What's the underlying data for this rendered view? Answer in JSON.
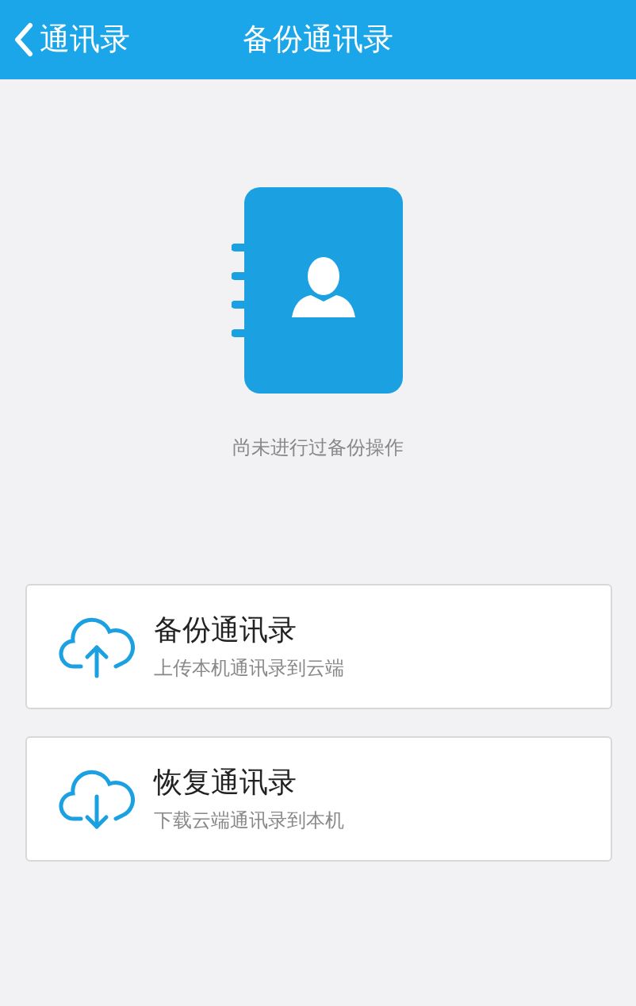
{
  "header": {
    "back_label": "通讯录",
    "title": "备份通讯录"
  },
  "status_text": "尚未进行过备份操作",
  "actions": [
    {
      "kind": "upload",
      "title": "备份通讯录",
      "subtitle": "上传本机通讯录到云端"
    },
    {
      "kind": "download",
      "title": "恢复通讯录",
      "subtitle": "下载云端通讯录到本机"
    }
  ]
}
